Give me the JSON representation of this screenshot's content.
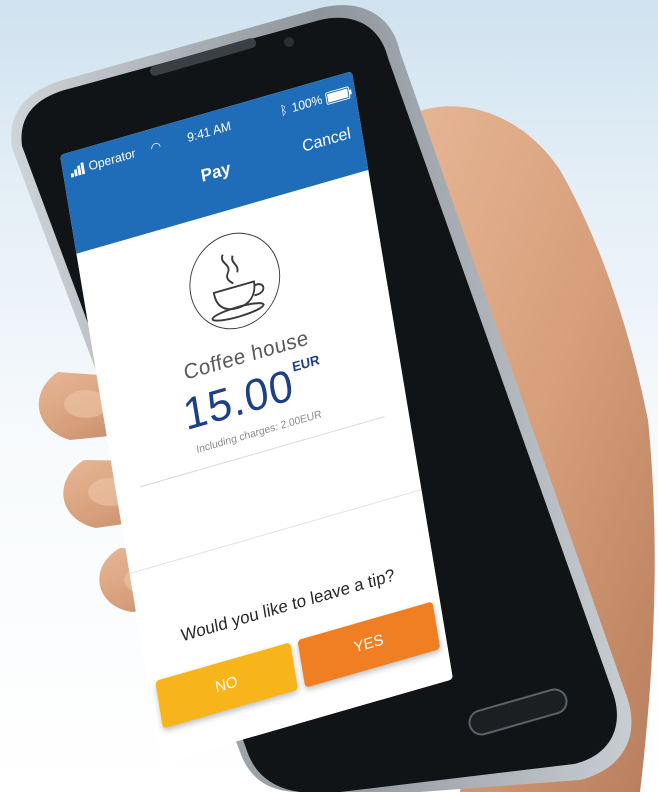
{
  "status_bar": {
    "operator": "Operator",
    "time": "9:41 AM",
    "battery": "100%"
  },
  "nav": {
    "title": "Pay",
    "cancel_label": "Cancel"
  },
  "payment": {
    "merchant": "Coffee house",
    "amount": "15.00",
    "currency": "EUR",
    "charges_note": "Including charges: 2.00EUR"
  },
  "tip_prompt": {
    "question": "Would you like to leave a tip?",
    "no_label": "NO",
    "yes_label": "YES"
  },
  "colors": {
    "header": "#1f6db8",
    "amount": "#1c3f86",
    "no_button": "#f7b51b",
    "yes_button": "#ef7f22"
  },
  "icons": {
    "merchant_logo": "coffee-cup-icon",
    "wifi": "wifi-icon",
    "bluetooth": "bluetooth-icon",
    "battery": "battery-icon",
    "signal": "signal-icon"
  }
}
